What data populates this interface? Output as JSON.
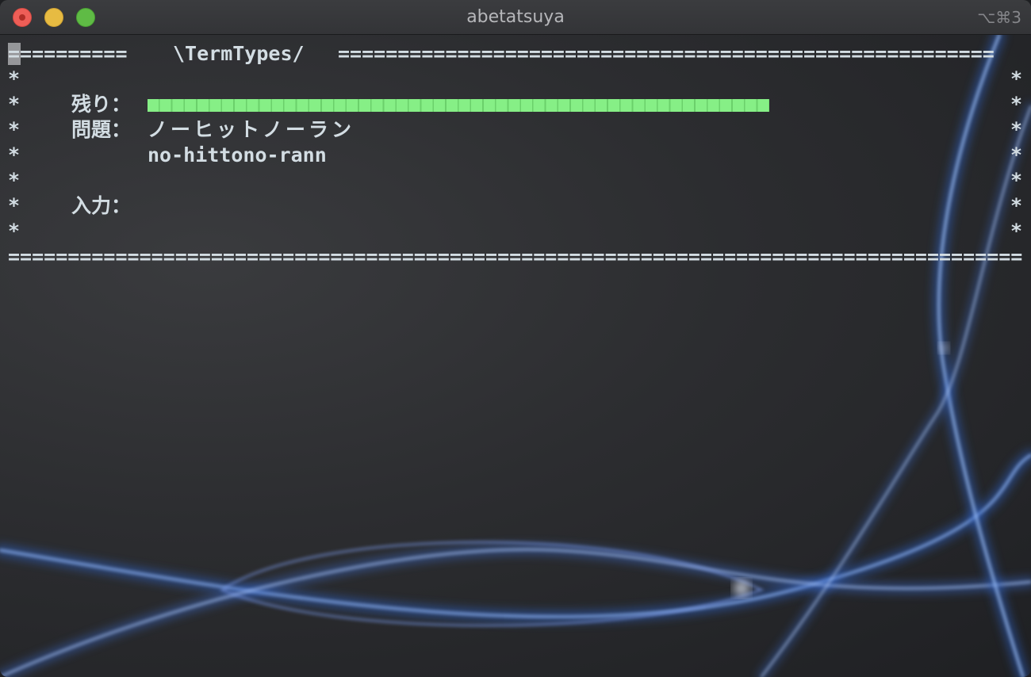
{
  "window": {
    "title": "abetatsuya",
    "shortcut": "⌥⌘3"
  },
  "terminal": {
    "top_rule_left": "==========",
    "banner": "\\TermTypes/",
    "top_rule_right": "=======================================================",
    "bottom_rule": "======================================================================================================",
    "star": "*",
    "remaining_label": "残り：",
    "remaining_fraction": 1.0,
    "question_label": "問題：",
    "question_kana": "ノーヒットノーラン",
    "question_romaji": "no-hittono-rann",
    "input_label": "入力：",
    "input_value": ""
  },
  "colors": {
    "progress": "#86ef86",
    "text": "#d3dde3",
    "close": "#ee5e57",
    "minimize": "#e7bb42",
    "maximize": "#5fbb45"
  }
}
